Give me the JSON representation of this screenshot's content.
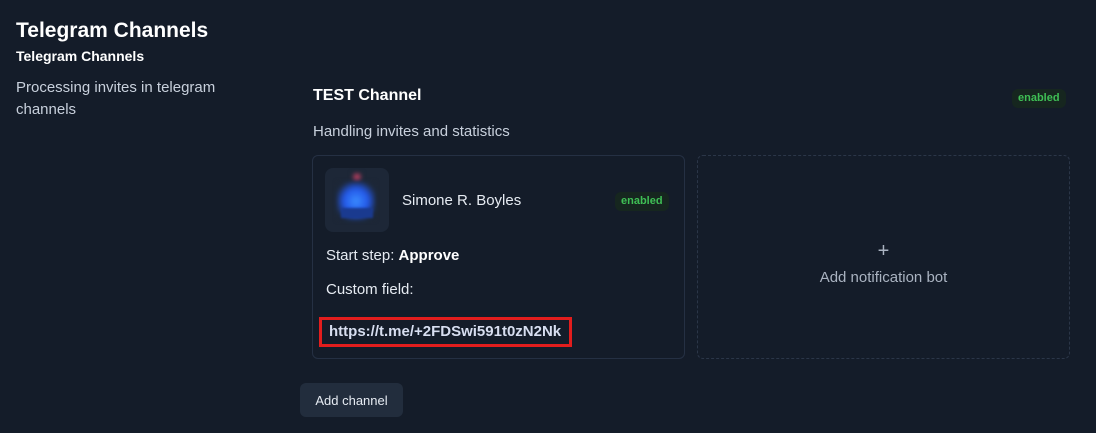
{
  "page": {
    "title": "Telegram Channels",
    "subtitle": "Telegram Channels",
    "description": "Processing invites in telegram channels"
  },
  "channel": {
    "name": "TEST Channel",
    "status": "enabled",
    "description": "Handling invites and statistics"
  },
  "bot": {
    "name": "Simone R. Boyles",
    "status": "enabled",
    "start_step_label": "Start step:",
    "start_step_value": "Approve",
    "custom_field_label": "Custom field:",
    "invite_link": "https://t.me/+2FDSwi591t0zN2Nk"
  },
  "add_bot": {
    "icon": "+",
    "label": "Add notification bot"
  },
  "add_channel_label": "Add channel",
  "colors": {
    "background": "#141c29",
    "badge_text": "#3fbf55",
    "highlight_border": "#e21d1d"
  }
}
